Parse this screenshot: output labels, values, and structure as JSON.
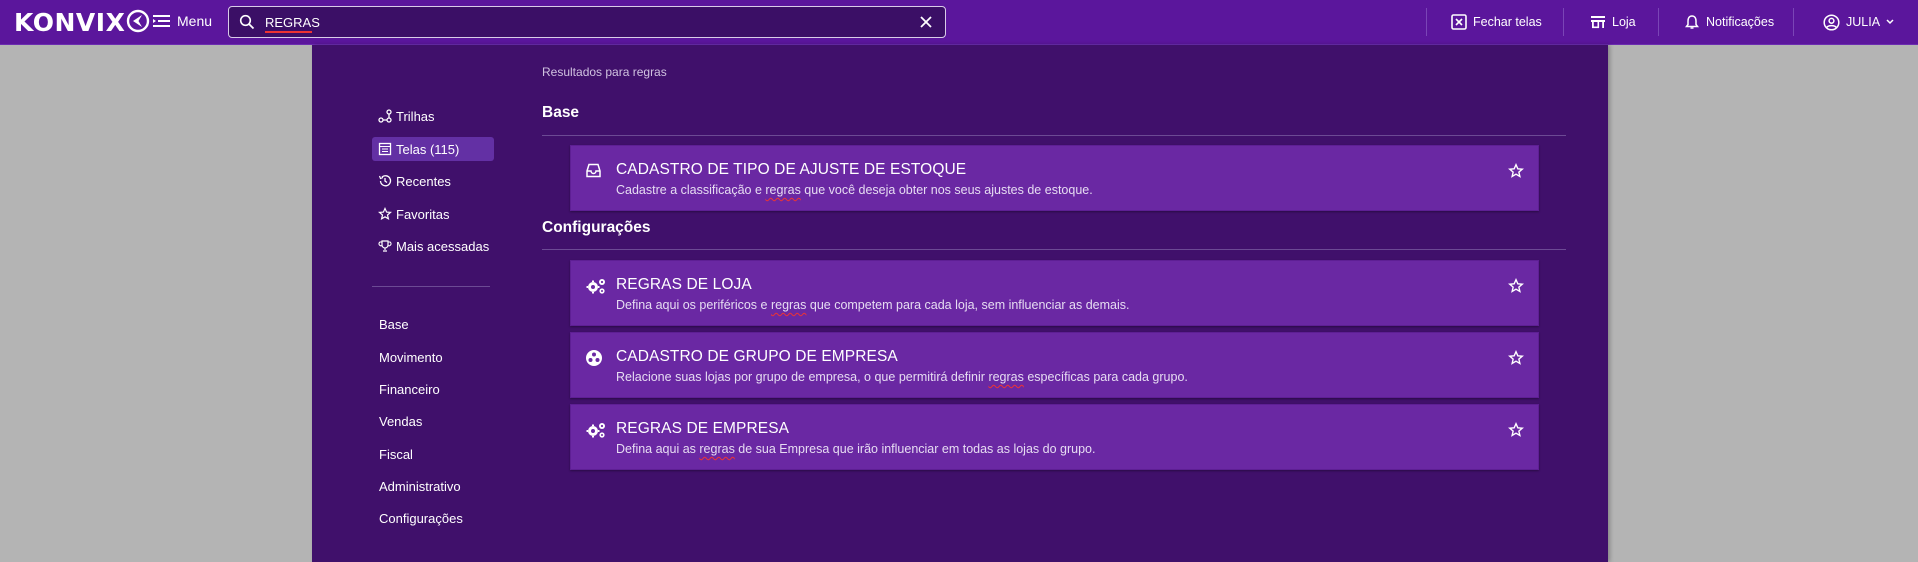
{
  "brand": {
    "logo_text": "KONVIX"
  },
  "topbar": {
    "menu_label": "Menu",
    "search_value": "REGRAS",
    "actions": [
      {
        "label": "Fechar telas",
        "icon": "close-box-icon"
      },
      {
        "label": "Loja",
        "icon": "store-icon"
      },
      {
        "label": "Notificações",
        "icon": "bell-icon"
      },
      {
        "label": "JULIA",
        "icon": "user-circle-icon"
      }
    ]
  },
  "sidebar": {
    "items": [
      {
        "label": "Trilhas",
        "icon": "trail-icon",
        "active": false
      },
      {
        "label": "Telas (115)",
        "icon": "screen-icon",
        "active": true
      },
      {
        "label": "Recentes",
        "icon": "history-icon",
        "active": false
      },
      {
        "label": "Favoritas",
        "icon": "star-icon",
        "active": false
      },
      {
        "label": "Mais acessadas",
        "icon": "trophy-icon",
        "active": false
      }
    ],
    "categories": [
      "Base",
      "Movimento",
      "Financeiro",
      "Vendas",
      "Fiscal",
      "Administrativo",
      "Configurações"
    ]
  },
  "results": {
    "label": "Resultados para regras",
    "sections": [
      {
        "title": "Base",
        "cards": [
          {
            "title": "CADASTRO DE TIPO DE AJUSTE DE ESTOQUE",
            "desc_before": "Cadastre a classificação e ",
            "desc_match": "regras",
            "desc_after": " que você deseja obter nos seus ajustes de estoque.",
            "icon": "inbox-icon"
          }
        ]
      },
      {
        "title": "Configurações",
        "cards": [
          {
            "title": "REGRAS DE LOJA",
            "desc_before": "Defina aqui os periféricos e ",
            "desc_match": "regras",
            "desc_after": " que competem para cada loja, sem influenciar as demais.",
            "icon": "gears-icon"
          },
          {
            "title": "CADASTRO DE GRUPO DE EMPRESA",
            "desc_before": "Relacione suas lojas por grupo de empresa, o que permitirá definir ",
            "desc_match": "regras",
            "desc_after": " específicas para cada grupo.",
            "icon": "group-icon"
          },
          {
            "title": "REGRAS DE EMPRESA",
            "desc_before": "Defina aqui as ",
            "desc_match": "regras",
            "desc_after": " de sua Empresa que irão influenciar em todas as lojas do grupo.",
            "icon": "gears-icon"
          }
        ]
      }
    ]
  },
  "colors": {
    "topbar": "#5b169c",
    "panel": "#40106b",
    "card": "#6a28a3",
    "active_item": "#6330a4",
    "backdrop": "#b4b4b4",
    "spellcheck": "#ee3333"
  }
}
